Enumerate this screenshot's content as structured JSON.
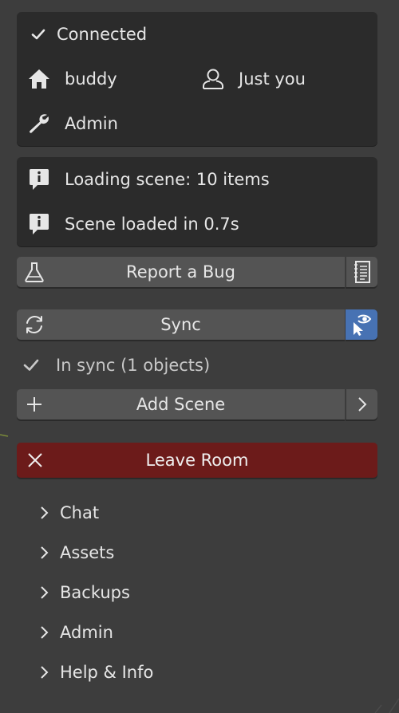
{
  "status_panel": {
    "connection": {
      "icon": "check-icon",
      "label": "Connected"
    },
    "room": {
      "icon": "home-icon",
      "label": "buddy"
    },
    "users": {
      "icon": "user-icon",
      "label": "Just you"
    },
    "role": {
      "icon": "wrench-icon",
      "label": "Admin"
    }
  },
  "log_panel": {
    "messages": [
      {
        "icon": "info-icon",
        "text": "Loading scene: 10 items"
      },
      {
        "icon": "info-icon",
        "text": "Scene loaded in 0.7s"
      }
    ]
  },
  "report_bug": {
    "icon": "flask-icon",
    "label": "Report a Bug",
    "side_icon": "document-icon"
  },
  "sync": {
    "icon": "refresh-icon",
    "label": "Sync",
    "side_icon": "eye-cursor-icon",
    "side_color": "#4772b3"
  },
  "sync_status": {
    "icon": "check-icon",
    "text": "In sync (1 objects)"
  },
  "add_scene": {
    "icon": "plus-icon",
    "label": "Add Scene",
    "side_icon": "chevron-right-icon"
  },
  "leave_room": {
    "icon": "close-icon",
    "label": "Leave Room",
    "color": "#6c1b1a"
  },
  "subpanels": [
    {
      "icon": "chevron-right-icon",
      "label": "Chat"
    },
    {
      "icon": "chevron-right-icon",
      "label": "Assets"
    },
    {
      "icon": "chevron-right-icon",
      "label": "Backups"
    },
    {
      "icon": "chevron-right-icon",
      "label": "Admin"
    },
    {
      "icon": "chevron-right-icon",
      "label": "Help & Info"
    }
  ],
  "colors": {
    "background": "#3d3d3d",
    "panel": "#2b2b2b",
    "button": "#545454",
    "accent": "#4772b3",
    "danger": "#6c1b1a"
  }
}
